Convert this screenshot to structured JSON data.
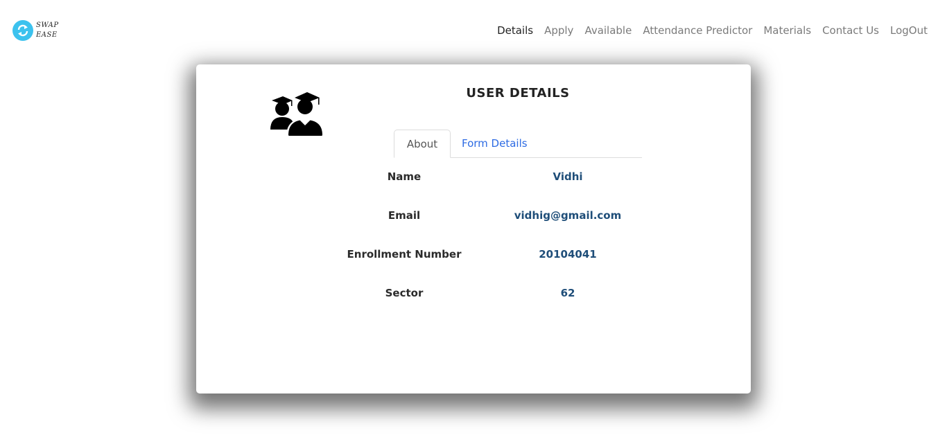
{
  "brand": {
    "line1": "SWAP",
    "line2": "EASE",
    "logo_color": "#3cc2ee",
    "logo_icon": "sync-arrows-icon"
  },
  "nav": {
    "items": [
      {
        "label": "Details",
        "active": true
      },
      {
        "label": "Apply",
        "active": false
      },
      {
        "label": "Available",
        "active": false
      },
      {
        "label": "Attendance Predictor",
        "active": false
      },
      {
        "label": "Materials",
        "active": false
      },
      {
        "label": "Contact Us",
        "active": false
      },
      {
        "label": "LogOut",
        "active": false
      }
    ]
  },
  "card": {
    "title": "USER DETAILS",
    "avatar_icon": "graduate-users-icon",
    "tabs": [
      {
        "label": "About",
        "active": true
      },
      {
        "label": "Form Details",
        "active": false
      }
    ],
    "fields": [
      {
        "label": "Name",
        "value": "Vidhi"
      },
      {
        "label": "Email",
        "value": "vidhig@gmail.com"
      },
      {
        "label": "Enrollment Number",
        "value": "20104041"
      },
      {
        "label": "Sector",
        "value": "62"
      }
    ]
  },
  "colors": {
    "link": "#2d6be3",
    "value": "#1f4e79",
    "nav_inactive": "#7a7a7a"
  }
}
